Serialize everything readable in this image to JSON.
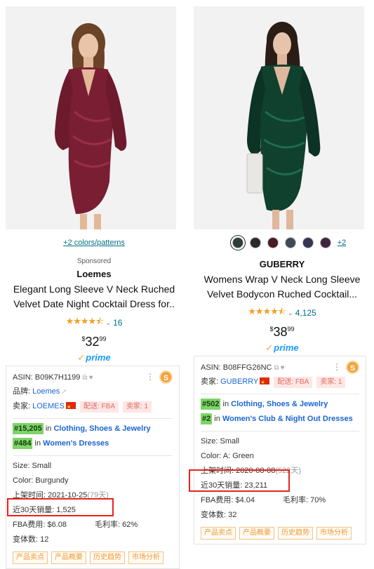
{
  "left_product": {
    "colors_link": "+2 colors/patterns",
    "sponsored": "Sponsored",
    "brand": "Loemes",
    "title_line1": "Elegant Long Sleeve V Neck Ruched",
    "title_line2": "Velvet Date Night Cocktail Dress for..",
    "stars": "★★★★⯪",
    "rating_count": "16",
    "price_symbol": "$",
    "price_whole": "32",
    "price_cents": "99",
    "prime": "prime",
    "dress_color": "#7a1f33"
  },
  "right_product": {
    "swatches": [
      "#2e3f38",
      "#2a2a2a",
      "#4a1c22",
      "#3e4a52",
      "#343653",
      "#3f2440"
    ],
    "swatch_more": "+2",
    "brand": "GUBERRY",
    "title_line1": "Womens Wrap V Neck Long Sleeve",
    "title_line2": "Velvet Bodycon Ruched Cocktail...",
    "stars": "★★★★⯪",
    "rating_count": "4,125",
    "price_symbol": "$",
    "price_whole": "38",
    "price_cents": "99",
    "prime": "prime",
    "dress_color": "#10402e"
  },
  "left_panel": {
    "asin": "ASIN: B09K7H1199",
    "brand_label": "品牌: ",
    "brand_value": "Loemes",
    "seller_label": "卖家: ",
    "seller_value": "LOEMES",
    "delivery_tag": "配送: FBA",
    "sellers_tag": "卖家: 1",
    "rank1": "#15,205",
    "rank1_in": " in ",
    "rank1_cat": "Clothing, Shoes & Jewelry",
    "rank2": "#484",
    "rank2_in": " in ",
    "rank2_cat": "Women's Dresses",
    "size": "Size: Small",
    "color": "Color: Burgundy",
    "listed_label": "上架时间: 2021-10-25",
    "listed_days": "(79天)",
    "sales": "近30天销量: 1,525",
    "fba_fee": "FBA费用: $6.08",
    "margin": "毛利率: 62%",
    "variants": "变体数: 12",
    "buttons": [
      "产品卖点",
      "产品概要",
      "历史趋势",
      "市场分析"
    ],
    "s_badge": "S"
  },
  "right_panel": {
    "asin": "ASIN: B08FFG26NC",
    "seller_label": "卖家: ",
    "seller_value": "GUBERRY",
    "delivery_tag": "配送: FBA",
    "sellers_tag": "卖家: 1",
    "rank1": "#502",
    "rank1_in": " in ",
    "rank1_cat": "Clothing, Shoes & Jewelry",
    "rank2": "#2",
    "rank2_in": " in ",
    "rank2_cat": "Women's Club & Night Out Dresses",
    "size": "Size: Small",
    "color": "Color: A: Green",
    "listed_label": "上架时间: 2020-08-08",
    "listed_days": "(522天)",
    "sales": "近30天销量: 23,211",
    "fba_fee": "FBA费用: $4.04",
    "margin": "毛利率: 70%",
    "variants": "变体数: 32",
    "buttons": [
      "产品卖点",
      "产品概要",
      "历史趋势",
      "市场分析"
    ],
    "s_badge": "S"
  }
}
